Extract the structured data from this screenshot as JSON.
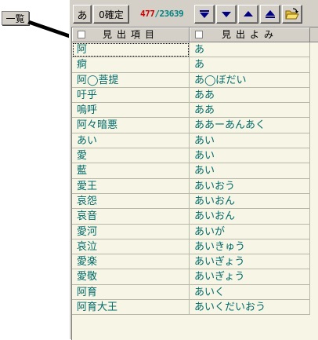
{
  "callout": {
    "label": "一覧"
  },
  "toolbar": {
    "btn_a": "あ",
    "btn_confirm": "0確定",
    "current": "477",
    "separator": "/",
    "total": "23639",
    "icons": [
      "first-icon",
      "next-icon",
      "previous-icon",
      "last-icon",
      "open-folder-icon"
    ]
  },
  "columns": {
    "headword": "見出項目",
    "reading": "見出よみ"
  },
  "rows": [
    {
      "headword": "阿",
      "reading": "あ"
    },
    {
      "headword": "痾",
      "reading": "あ"
    },
    {
      "headword": "阿◯菩提",
      "reading": "あ◯ぼだい"
    },
    {
      "headword": "吁乎",
      "reading": "ああ"
    },
    {
      "headword": "嗚呼",
      "reading": "ああ"
    },
    {
      "headword": "阿々暗悪",
      "reading": "ああーあんあく"
    },
    {
      "headword": "あい",
      "reading": "あい"
    },
    {
      "headword": "愛",
      "reading": "あい"
    },
    {
      "headword": "藍",
      "reading": "あい"
    },
    {
      "headword": "愛王",
      "reading": "あいおう"
    },
    {
      "headword": "哀怨",
      "reading": "あいおん"
    },
    {
      "headword": "哀音",
      "reading": "あいおん"
    },
    {
      "headword": "愛河",
      "reading": "あいが"
    },
    {
      "headword": "哀泣",
      "reading": "あいきゅう"
    },
    {
      "headword": "愛楽",
      "reading": "あいぎょう"
    },
    {
      "headword": "愛敬",
      "reading": "あいぎょう"
    },
    {
      "headword": "阿育",
      "reading": "あいく"
    },
    {
      "headword": "阿育大王",
      "reading": "あいくだいおう"
    }
  ],
  "colors": {
    "accent": "#00a0a0",
    "text": "#006a6a",
    "counter_current": "#d00000",
    "grid_bg": "#f7f6e6"
  }
}
